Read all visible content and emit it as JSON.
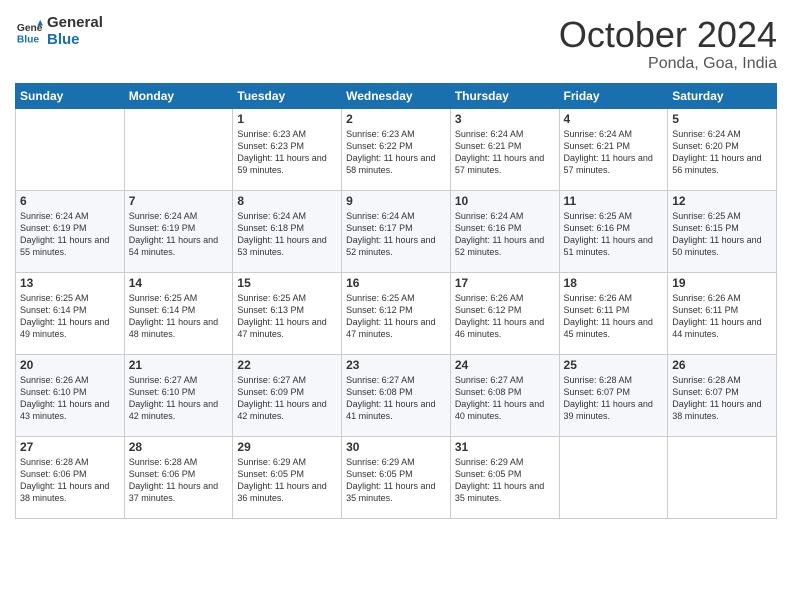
{
  "logo": {
    "line1": "General",
    "line2": "Blue"
  },
  "header": {
    "month": "October 2024",
    "location": "Ponda, Goa, India"
  },
  "days_of_week": [
    "Sunday",
    "Monday",
    "Tuesday",
    "Wednesday",
    "Thursday",
    "Friday",
    "Saturday"
  ],
  "weeks": [
    [
      {
        "day": "",
        "sunrise": "",
        "sunset": "",
        "daylight": ""
      },
      {
        "day": "",
        "sunrise": "",
        "sunset": "",
        "daylight": ""
      },
      {
        "day": "1",
        "sunrise": "Sunrise: 6:23 AM",
        "sunset": "Sunset: 6:23 PM",
        "daylight": "Daylight: 11 hours and 59 minutes."
      },
      {
        "day": "2",
        "sunrise": "Sunrise: 6:23 AM",
        "sunset": "Sunset: 6:22 PM",
        "daylight": "Daylight: 11 hours and 58 minutes."
      },
      {
        "day": "3",
        "sunrise": "Sunrise: 6:24 AM",
        "sunset": "Sunset: 6:21 PM",
        "daylight": "Daylight: 11 hours and 57 minutes."
      },
      {
        "day": "4",
        "sunrise": "Sunrise: 6:24 AM",
        "sunset": "Sunset: 6:21 PM",
        "daylight": "Daylight: 11 hours and 57 minutes."
      },
      {
        "day": "5",
        "sunrise": "Sunrise: 6:24 AM",
        "sunset": "Sunset: 6:20 PM",
        "daylight": "Daylight: 11 hours and 56 minutes."
      }
    ],
    [
      {
        "day": "6",
        "sunrise": "Sunrise: 6:24 AM",
        "sunset": "Sunset: 6:19 PM",
        "daylight": "Daylight: 11 hours and 55 minutes."
      },
      {
        "day": "7",
        "sunrise": "Sunrise: 6:24 AM",
        "sunset": "Sunset: 6:19 PM",
        "daylight": "Daylight: 11 hours and 54 minutes."
      },
      {
        "day": "8",
        "sunrise": "Sunrise: 6:24 AM",
        "sunset": "Sunset: 6:18 PM",
        "daylight": "Daylight: 11 hours and 53 minutes."
      },
      {
        "day": "9",
        "sunrise": "Sunrise: 6:24 AM",
        "sunset": "Sunset: 6:17 PM",
        "daylight": "Daylight: 11 hours and 52 minutes."
      },
      {
        "day": "10",
        "sunrise": "Sunrise: 6:24 AM",
        "sunset": "Sunset: 6:16 PM",
        "daylight": "Daylight: 11 hours and 52 minutes."
      },
      {
        "day": "11",
        "sunrise": "Sunrise: 6:25 AM",
        "sunset": "Sunset: 6:16 PM",
        "daylight": "Daylight: 11 hours and 51 minutes."
      },
      {
        "day": "12",
        "sunrise": "Sunrise: 6:25 AM",
        "sunset": "Sunset: 6:15 PM",
        "daylight": "Daylight: 11 hours and 50 minutes."
      }
    ],
    [
      {
        "day": "13",
        "sunrise": "Sunrise: 6:25 AM",
        "sunset": "Sunset: 6:14 PM",
        "daylight": "Daylight: 11 hours and 49 minutes."
      },
      {
        "day": "14",
        "sunrise": "Sunrise: 6:25 AM",
        "sunset": "Sunset: 6:14 PM",
        "daylight": "Daylight: 11 hours and 48 minutes."
      },
      {
        "day": "15",
        "sunrise": "Sunrise: 6:25 AM",
        "sunset": "Sunset: 6:13 PM",
        "daylight": "Daylight: 11 hours and 47 minutes."
      },
      {
        "day": "16",
        "sunrise": "Sunrise: 6:25 AM",
        "sunset": "Sunset: 6:12 PM",
        "daylight": "Daylight: 11 hours and 47 minutes."
      },
      {
        "day": "17",
        "sunrise": "Sunrise: 6:26 AM",
        "sunset": "Sunset: 6:12 PM",
        "daylight": "Daylight: 11 hours and 46 minutes."
      },
      {
        "day": "18",
        "sunrise": "Sunrise: 6:26 AM",
        "sunset": "Sunset: 6:11 PM",
        "daylight": "Daylight: 11 hours and 45 minutes."
      },
      {
        "day": "19",
        "sunrise": "Sunrise: 6:26 AM",
        "sunset": "Sunset: 6:11 PM",
        "daylight": "Daylight: 11 hours and 44 minutes."
      }
    ],
    [
      {
        "day": "20",
        "sunrise": "Sunrise: 6:26 AM",
        "sunset": "Sunset: 6:10 PM",
        "daylight": "Daylight: 11 hours and 43 minutes."
      },
      {
        "day": "21",
        "sunrise": "Sunrise: 6:27 AM",
        "sunset": "Sunset: 6:10 PM",
        "daylight": "Daylight: 11 hours and 42 minutes."
      },
      {
        "day": "22",
        "sunrise": "Sunrise: 6:27 AM",
        "sunset": "Sunset: 6:09 PM",
        "daylight": "Daylight: 11 hours and 42 minutes."
      },
      {
        "day": "23",
        "sunrise": "Sunrise: 6:27 AM",
        "sunset": "Sunset: 6:08 PM",
        "daylight": "Daylight: 11 hours and 41 minutes."
      },
      {
        "day": "24",
        "sunrise": "Sunrise: 6:27 AM",
        "sunset": "Sunset: 6:08 PM",
        "daylight": "Daylight: 11 hours and 40 minutes."
      },
      {
        "day": "25",
        "sunrise": "Sunrise: 6:28 AM",
        "sunset": "Sunset: 6:07 PM",
        "daylight": "Daylight: 11 hours and 39 minutes."
      },
      {
        "day": "26",
        "sunrise": "Sunrise: 6:28 AM",
        "sunset": "Sunset: 6:07 PM",
        "daylight": "Daylight: 11 hours and 38 minutes."
      }
    ],
    [
      {
        "day": "27",
        "sunrise": "Sunrise: 6:28 AM",
        "sunset": "Sunset: 6:06 PM",
        "daylight": "Daylight: 11 hours and 38 minutes."
      },
      {
        "day": "28",
        "sunrise": "Sunrise: 6:28 AM",
        "sunset": "Sunset: 6:06 PM",
        "daylight": "Daylight: 11 hours and 37 minutes."
      },
      {
        "day": "29",
        "sunrise": "Sunrise: 6:29 AM",
        "sunset": "Sunset: 6:05 PM",
        "daylight": "Daylight: 11 hours and 36 minutes."
      },
      {
        "day": "30",
        "sunrise": "Sunrise: 6:29 AM",
        "sunset": "Sunset: 6:05 PM",
        "daylight": "Daylight: 11 hours and 35 minutes."
      },
      {
        "day": "31",
        "sunrise": "Sunrise: 6:29 AM",
        "sunset": "Sunset: 6:05 PM",
        "daylight": "Daylight: 11 hours and 35 minutes."
      },
      {
        "day": "",
        "sunrise": "",
        "sunset": "",
        "daylight": ""
      },
      {
        "day": "",
        "sunrise": "",
        "sunset": "",
        "daylight": ""
      }
    ]
  ]
}
